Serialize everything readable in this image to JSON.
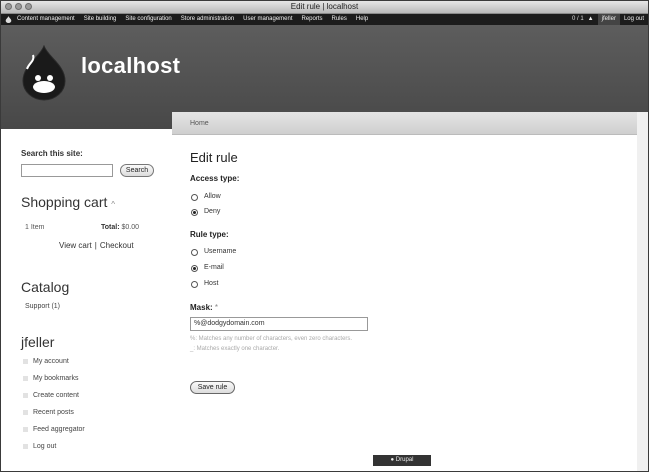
{
  "window": {
    "title": "Edit rule | localhost"
  },
  "admin_menu": {
    "items": [
      "Content management",
      "Site building",
      "Site configuration",
      "Store administration",
      "User management",
      "Reports",
      "Rules",
      "Help"
    ],
    "counts": "0 / 1",
    "user": "jfeller",
    "logout": "Log out"
  },
  "header": {
    "site_name": "localhost"
  },
  "breadcrumb": {
    "home": "Home"
  },
  "search": {
    "label": "Search this site:",
    "value": "",
    "button": "Search"
  },
  "cart": {
    "title": "Shopping cart",
    "arrow": "^",
    "item_count": "1 Item",
    "total_label": "Total:",
    "total_value": "$0.00",
    "view_cart": "View cart",
    "separator": "|",
    "checkout": "Checkout"
  },
  "catalog": {
    "title": "Catalog",
    "items": [
      "Support (1)"
    ]
  },
  "user_block": {
    "title": "jfeller",
    "links": [
      "My account",
      "My bookmarks",
      "Create content",
      "Recent posts",
      "Feed aggregator",
      "Log out"
    ]
  },
  "form": {
    "title": "Edit rule",
    "access_type": {
      "label": "Access type:",
      "options": [
        "Allow",
        "Deny"
      ],
      "selected": "Deny"
    },
    "rule_type": {
      "label": "Rule type:",
      "options": [
        "Username",
        "E-mail",
        "Host"
      ],
      "selected": "E-mail"
    },
    "mask": {
      "label": "Mask:",
      "required": "*",
      "value": "%@dodgydomain.com",
      "desc1": "%: Matches any number of characters, even zero characters.",
      "desc2": "_: Matches exactly one character."
    },
    "save_button": "Save rule"
  },
  "footer": {
    "badge": "Drupal"
  },
  "colors": {
    "header_bg": "#4f4f4f",
    "admin_bar_bg": "#1c1c1c"
  }
}
